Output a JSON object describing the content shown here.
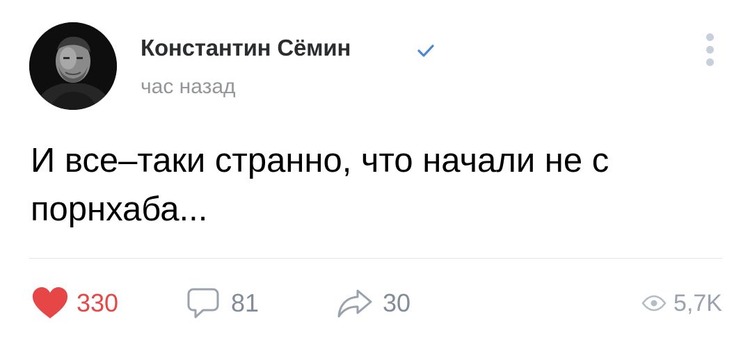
{
  "author": {
    "name": "Константин Сёмин",
    "verified": true,
    "avatar_icon": "author-photo"
  },
  "post": {
    "time": "час назад",
    "text": "И все–таки странно, что начали не с порнхаба..."
  },
  "actions": {
    "likes": "330",
    "comments": "81",
    "shares": "30",
    "views": "5,7K"
  },
  "colors": {
    "like": "#e64646",
    "muted": "#818c99",
    "verified": "#4a88d4",
    "dots": "#c5d0db"
  }
}
